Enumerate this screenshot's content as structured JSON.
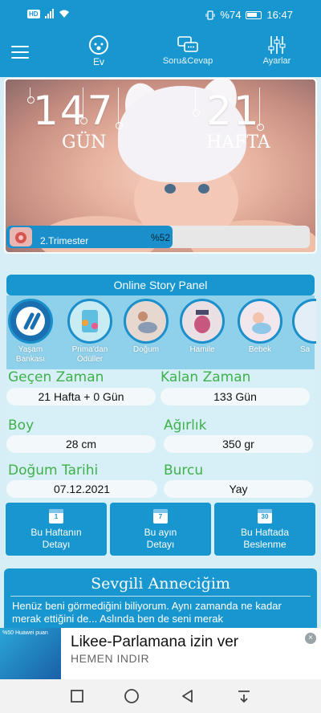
{
  "status_bar": {
    "battery": "%74",
    "time": "16:47",
    "network": "HD"
  },
  "nav": [
    {
      "label": "Ev",
      "icon": "baby-face-icon",
      "active": true
    },
    {
      "label": "Soru&Cevap",
      "icon": "chat-bubbles-icon",
      "active": false
    },
    {
      "label": "Ayarlar",
      "icon": "sliders-icon",
      "active": false
    }
  ],
  "hero": {
    "days_value": "147",
    "days_label": "GÜN",
    "weeks_value": "21",
    "weeks_label": "HAFTA",
    "trimester_label": "2.Trimester",
    "trimester_percent_text": "%52",
    "trimester_progress": 0.52
  },
  "panel": {
    "title": "Online Story Panel",
    "stories": [
      {
        "label": "Yaşam Bankası",
        "icon": "life-bank-icon"
      },
      {
        "label": "Prima'dan Ödüller",
        "icon": "gift-icon"
      },
      {
        "label": "Doğum",
        "icon": "birth-icon"
      },
      {
        "label": "Hamile",
        "icon": "pregnant-icon"
      },
      {
        "label": "Bebek",
        "icon": "baby-icon"
      },
      {
        "label": "Sa",
        "icon": "health-icon"
      }
    ],
    "fields": {
      "elapsed": {
        "label": "Geçen Zaman",
        "value": "21 Hafta + 0 Gün"
      },
      "remaining": {
        "label": "Kalan Zaman",
        "value": "133 Gün"
      },
      "height": {
        "label": "Boy",
        "value": "28 cm"
      },
      "weight": {
        "label": "Ağırlık",
        "value": "350 gr"
      },
      "birth_date": {
        "label": "Doğum Tarihi",
        "value": "07.12.2021"
      },
      "zodiac": {
        "label": "Burcu",
        "value": "Yay"
      }
    },
    "buttons": [
      {
        "cal": "1",
        "line1": "Bu Haftanın",
        "line2": "Detayı"
      },
      {
        "cal": "7",
        "line1": "Bu ayın",
        "line2": "Detayı"
      },
      {
        "cal": "30",
        "line1": "Bu Haftada",
        "line2": "Beslenme"
      }
    ]
  },
  "letter": {
    "title": "Sevgili Anneciğim",
    "body": "Henüz beni görmediğini biliyorum. Aynı zamanda ne kadar merak ettiğini de... Aslında ben de seni merak"
  },
  "ad": {
    "image_text": "%50 Huawei puan",
    "title": "Likee-Parlamana izin ver",
    "subtitle": "HEMEN INDIR"
  },
  "colors": {
    "primary": "#1896cf",
    "label_green": "#3fb04a",
    "panel_bg": "#d7f0f8"
  }
}
